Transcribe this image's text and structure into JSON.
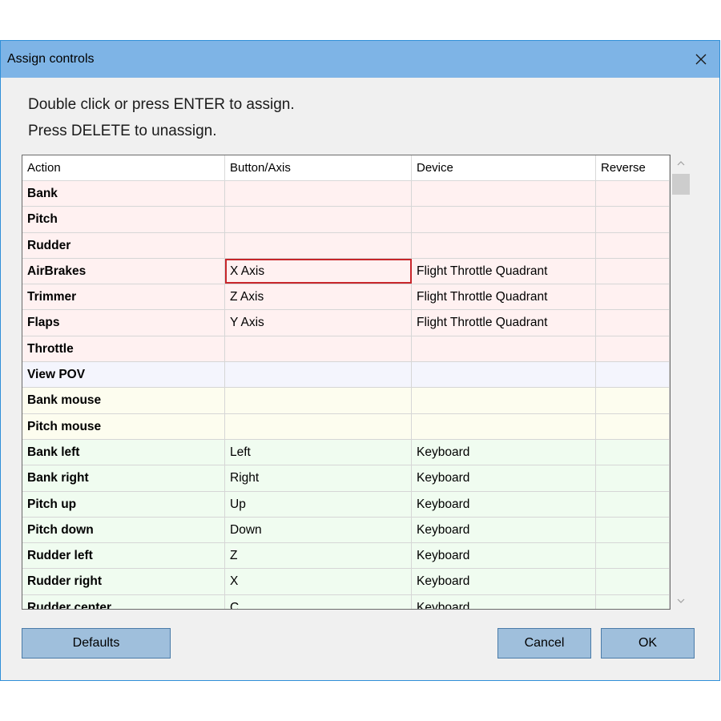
{
  "window": {
    "title": "Assign controls",
    "close_icon": "close-icon"
  },
  "instructions": {
    "line1": "Double click or press ENTER to assign.",
    "line2": "Press DELETE to unassign."
  },
  "grid": {
    "columns": [
      "Action",
      "Button/Axis",
      "Device",
      "Reverse"
    ],
    "rows": [
      {
        "action": "Bank",
        "button": "",
        "device": "",
        "reverse": "",
        "group": "axis"
      },
      {
        "action": "Pitch",
        "button": "",
        "device": "",
        "reverse": "",
        "group": "axis"
      },
      {
        "action": "Rudder",
        "button": "",
        "device": "",
        "reverse": "",
        "group": "axis"
      },
      {
        "action": "AirBrakes",
        "button": "X Axis",
        "device": "Flight Throttle Quadrant",
        "reverse": "",
        "group": "axis",
        "selected": true
      },
      {
        "action": "Trimmer",
        "button": "Z Axis",
        "device": "Flight Throttle Quadrant",
        "reverse": "",
        "group": "axis"
      },
      {
        "action": "Flaps",
        "button": "Y Axis",
        "device": "Flight Throttle Quadrant",
        "reverse": "",
        "group": "axis"
      },
      {
        "action": "Throttle",
        "button": "",
        "device": "",
        "reverse": "",
        "group": "axis"
      },
      {
        "action": "View POV",
        "button": "",
        "device": "",
        "reverse": "",
        "group": "pov"
      },
      {
        "action": "Bank mouse",
        "button": "",
        "device": "",
        "reverse": "",
        "group": "mouse"
      },
      {
        "action": "Pitch mouse",
        "button": "",
        "device": "",
        "reverse": "",
        "group": "mouse"
      },
      {
        "action": "Bank left",
        "button": "Left",
        "device": "Keyboard",
        "reverse": "",
        "group": "key"
      },
      {
        "action": "Bank right",
        "button": "Right",
        "device": "Keyboard",
        "reverse": "",
        "group": "key"
      },
      {
        "action": "Pitch up",
        "button": "Up",
        "device": "Keyboard",
        "reverse": "",
        "group": "key"
      },
      {
        "action": "Pitch down",
        "button": "Down",
        "device": "Keyboard",
        "reverse": "",
        "group": "key"
      },
      {
        "action": "Rudder left",
        "button": "Z",
        "device": "Keyboard",
        "reverse": "",
        "group": "key"
      },
      {
        "action": "Rudder right",
        "button": "X",
        "device": "Keyboard",
        "reverse": "",
        "group": "key"
      },
      {
        "action": "Rudder center",
        "button": "C",
        "device": "Keyboard",
        "reverse": "",
        "group": "key"
      }
    ],
    "colors": {
      "axis": "#fff1f1",
      "pov": "#f4f5fd",
      "mouse": "#fdfdef",
      "key": "#f0fcf0",
      "selected_border": "#c8262b"
    }
  },
  "scrollbar": {
    "up_icon": "chevron-up-icon",
    "down_icon": "chevron-down-icon",
    "position": 0.0
  },
  "buttons": {
    "defaults": "Defaults",
    "cancel": "Cancel",
    "ok": "OK"
  },
  "colors": {
    "titlebar": "#7eb4e6",
    "button_bg": "#9fbfdc",
    "dialog_bg": "#f0f0f0"
  }
}
